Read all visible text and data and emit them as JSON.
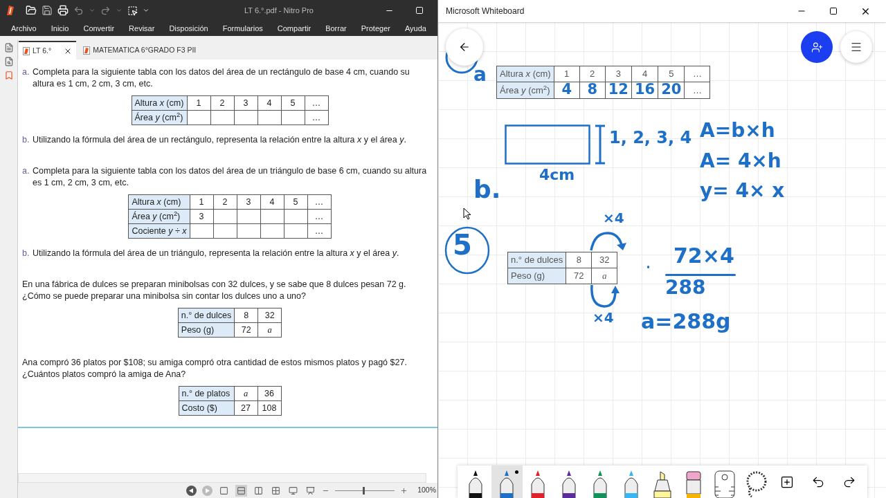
{
  "pdf_viewer": {
    "title": "LT 6.°.pdf - Nitro Pro",
    "menu": [
      "Archivo",
      "Inicio",
      "Convertir",
      "Revisar",
      "Disposición",
      "Formularios",
      "Compartir",
      "Borrar",
      "Proteger",
      "Ayuda"
    ],
    "tabs": [
      {
        "label": "LT 6.°",
        "selected": true
      },
      {
        "label": "MATEMATICA 6°GRADO F3 PII",
        "selected": false
      }
    ],
    "blocks": [
      {
        "kind": "question",
        "marker": "a.",
        "text": "Completa para la siguiente tabla con los datos del área de un rectángulo de base 4 cm, cuando su altura es 1 cm, 2 cm, 3 cm, etc."
      },
      {
        "kind": "table",
        "rows": [
          {
            "label": "Altura *x* (cm)",
            "cells": [
              "1",
              "2",
              "3",
              "4",
              "5",
              "…"
            ]
          },
          {
            "label": "Área *y* (cm$^{2}$)",
            "cells": [
              null,
              null,
              null,
              null,
              null,
              "…"
            ]
          }
        ]
      },
      {
        "kind": "question",
        "marker": "b.",
        "text": "Utilizando la fórmula del área de un rectángulo, representa la relación entre la altura *x* y el área *y*."
      },
      {
        "kind": "question",
        "marker": "a.",
        "text": "Completa para la siguiente tabla con los datos del área de un triángulo de base 6 cm, cuando su altura es 1 cm, 2 cm, 3 cm, etc."
      },
      {
        "kind": "table",
        "rows": [
          {
            "label": "Altura *x* (cm)",
            "cells": [
              "1",
              "2",
              "3",
              "4",
              "5",
              "…"
            ]
          },
          {
            "label": "Área *y* (cm$^{2}$)",
            "cells": [
              "3",
              null,
              null,
              null,
              null,
              "…"
            ]
          },
          {
            "label": "Cociente *y ÷ x*",
            "cells": [
              null,
              null,
              null,
              null,
              null,
              "…"
            ]
          }
        ]
      },
      {
        "kind": "question",
        "marker": "b.",
        "text": "Utilizando la fórmula del área de un triángulo, representa la relación entre la altura *x* y el área *y*."
      },
      {
        "kind": "question",
        "text": "En una fábrica de dulces se preparan minibolsas con 32 dulces, y se sabe que 8 dulces pesan 72 g. ¿Cómo se puede preparar una minibolsa sin contar los dulces uno a uno?"
      },
      {
        "kind": "table",
        "rows": [
          {
            "label": "n.° de dulces",
            "cells": [
              "8",
              "32"
            ]
          },
          {
            "label": "Peso (g)",
            "cells": [
              "72",
              {
                "text": "a",
                "kind": "variable"
              }
            ]
          }
        ]
      },
      {
        "kind": "question",
        "text": "Ana compró 36 platos por $108; su amiga compró otra cantidad de estos mismos platos y pagó $27. ¿Cuántos platos compró la amiga de Ana?"
      },
      {
        "kind": "table",
        "rows": [
          {
            "label": "n.° de platos",
            "cells": [
              {
                "text": "a",
                "kind": "variable"
              },
              "36"
            ]
          },
          {
            "label": "Costo ($)",
            "cells": [
              "27",
              "108"
            ]
          }
        ]
      }
    ],
    "view_modes": [
      {
        "selected": false
      },
      {
        "selected": true
      },
      {
        "selected": false
      },
      {
        "selected": false
      },
      {
        "selected": false
      },
      {
        "selected": false
      }
    ],
    "zoom": {
      "level": 0.48,
      "reading": "100%"
    }
  },
  "whiteboard": {
    "title": "Microsoft Whiteboard",
    "tables": [
      {
        "rows": [
          {
            "label": "Altura *x* (cm)",
            "cells": [
              "1",
              "2",
              "3",
              "4",
              "5",
              "…"
            ]
          },
          {
            "label": "Área *y* (cm$^{2}$)",
            "cells": [
              {
                "text": "4",
                "kind": "ink"
              },
              {
                "text": "8",
                "kind": "ink"
              },
              {
                "text": "12",
                "kind": "ink"
              },
              {
                "text": "16",
                "kind": "ink"
              },
              {
                "text": "20",
                "kind": "ink"
              },
              "…"
            ]
          }
        ]
      },
      {
        "rows": [
          {
            "label": "n.° de dulces",
            "cells": [
              "8",
              "32"
            ]
          },
          {
            "label": "Peso (g)",
            "cells": [
              "72",
              {
                "text": "a",
                "kind": "variable"
              }
            ]
          }
        ]
      }
    ],
    "ink": [
      "a",
      "1, 2, 3, 4",
      "4cm",
      "b.",
      "A=b×h",
      "A= 4×h",
      "y= 4× x",
      "5",
      "×4",
      "×4",
      "72×4",
      "288",
      "a=288g"
    ],
    "tools": [
      {
        "kind": "pen",
        "color": "#111111",
        "selected": false
      },
      {
        "kind": "pen",
        "color": "#1e6fc8",
        "selected": true
      },
      {
        "kind": "pen",
        "color": "#e0202a",
        "selected": false
      },
      {
        "kind": "pen",
        "color": "#5b2d9c",
        "selected": false
      },
      {
        "kind": "pen",
        "color": "#12915a",
        "selected": false
      },
      {
        "kind": "pen",
        "color": "#35b6f0",
        "selected": false
      },
      {
        "kind": "highlighter",
        "color": "#fff59a",
        "selected": false
      },
      {
        "kind": "eraser",
        "selected": false
      },
      {
        "kind": "ruler",
        "selected": false
      },
      {
        "kind": "lasso",
        "selected": false
      },
      {
        "kind": "add",
        "selected": false
      },
      {
        "kind": "undo",
        "selected": false
      },
      {
        "kind": "redo",
        "selected": false
      }
    ]
  }
}
